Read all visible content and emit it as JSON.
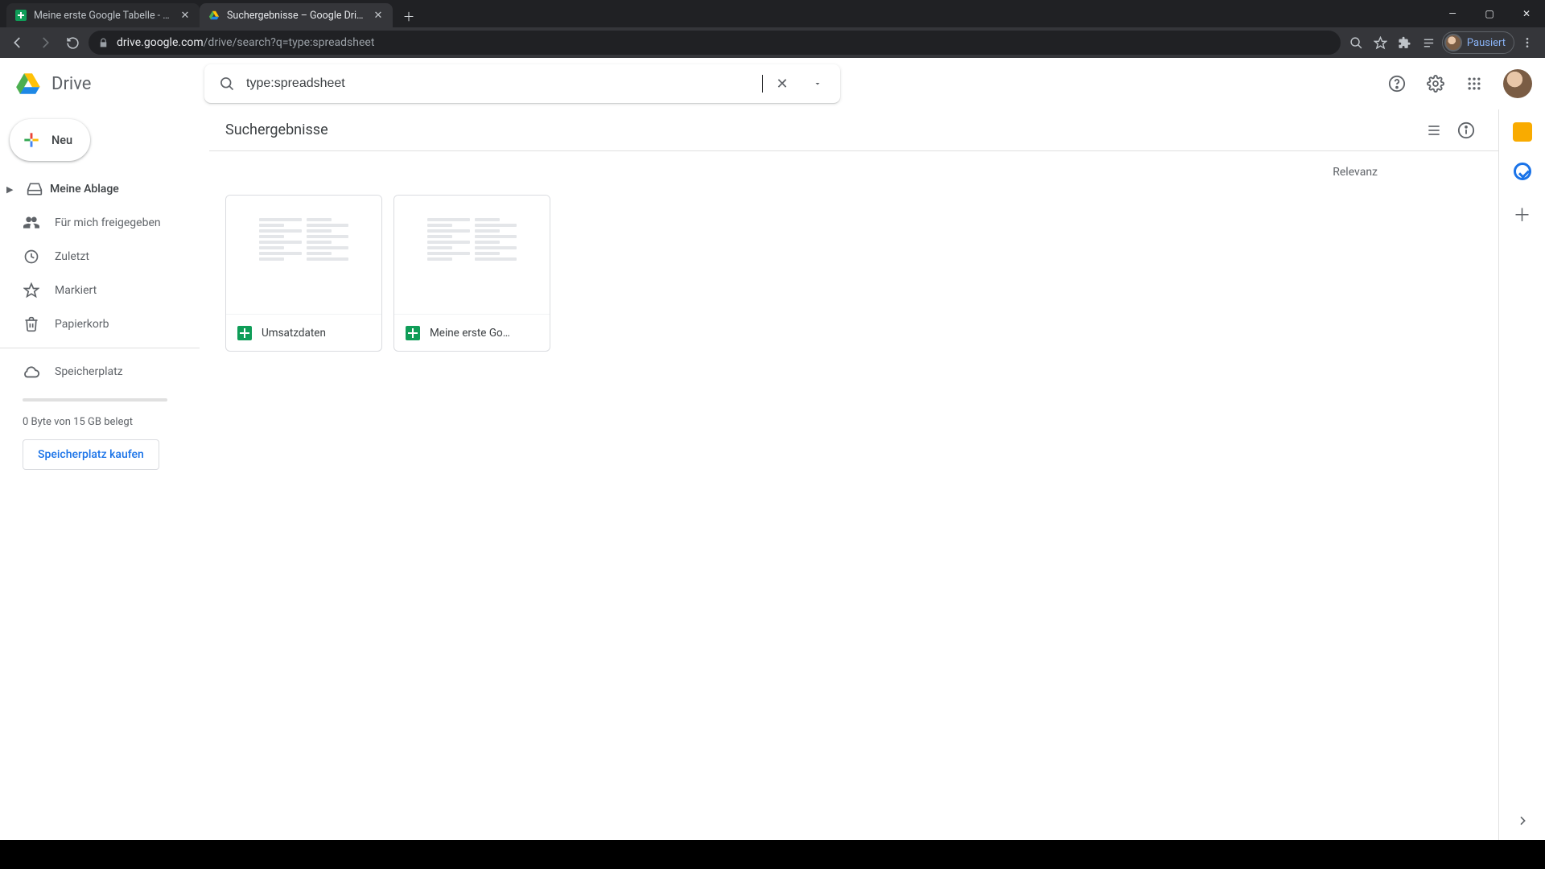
{
  "browser": {
    "tabs": [
      {
        "title": "Meine erste Google Tabelle - Go",
        "active": false,
        "favicon": "sheets"
      },
      {
        "title": "Suchergebnisse – Google Drive",
        "active": true,
        "favicon": "drive"
      }
    ],
    "url_host": "drive.google.com",
    "url_path": "/drive/search?q=type:spreadsheet",
    "profile_label": "Pausiert"
  },
  "header": {
    "brand": "Drive",
    "search_value": "type:spreadsheet"
  },
  "sidebar": {
    "new_label": "Neu",
    "items": [
      {
        "id": "my-drive",
        "label": "Meine Ablage",
        "has_chevron": true
      },
      {
        "id": "shared",
        "label": "Für mich freigegeben"
      },
      {
        "id": "recent",
        "label": "Zuletzt"
      },
      {
        "id": "starred",
        "label": "Markiert"
      },
      {
        "id": "trash",
        "label": "Papierkorb"
      }
    ],
    "storage_label": "Speicherplatz",
    "storage_usage": "0 Byte von 15 GB belegt",
    "buy_label": "Speicherplatz kaufen"
  },
  "main": {
    "title": "Suchergebnisse",
    "sort_label": "Relevanz",
    "files": [
      {
        "name": "Umsatzdaten"
      },
      {
        "name": "Meine erste Go…"
      }
    ]
  }
}
